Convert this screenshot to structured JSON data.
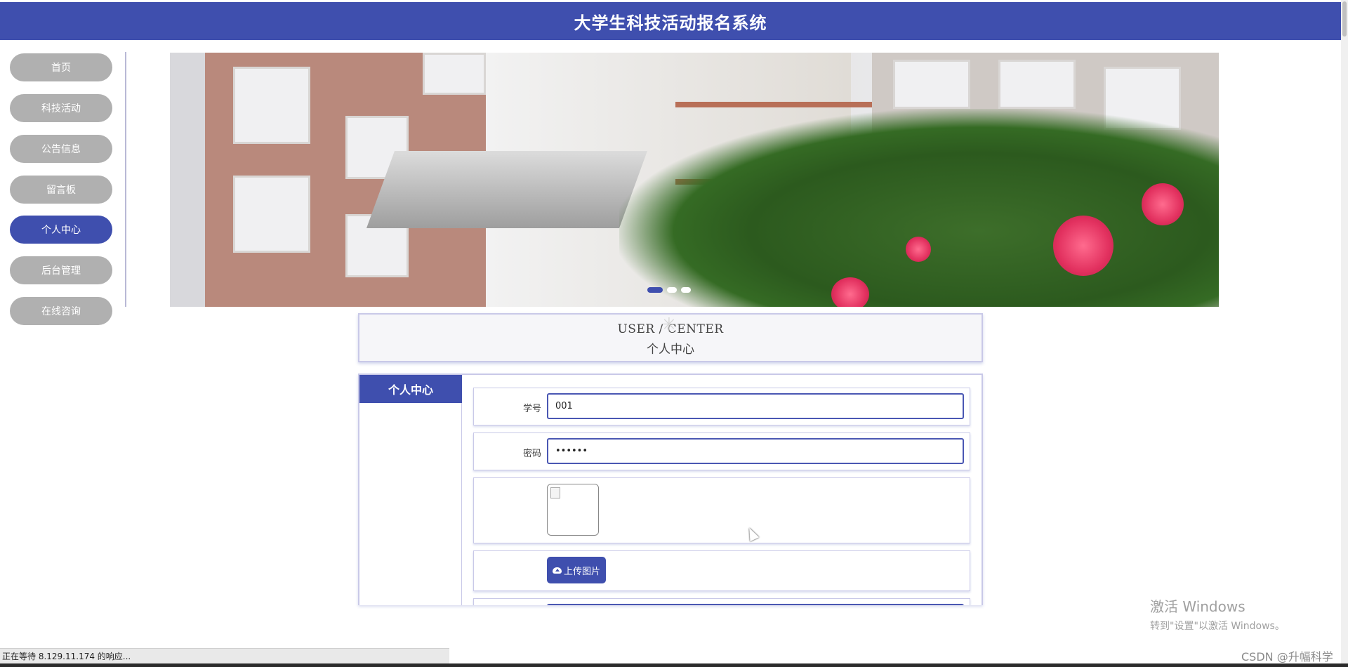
{
  "header": {
    "title": "大学生科技活动报名系统"
  },
  "sidebar": {
    "items": [
      {
        "label": "首页"
      },
      {
        "label": "科技活动"
      },
      {
        "label": "公告信息"
      },
      {
        "label": "留言板"
      },
      {
        "label": "个人中心",
        "active": true
      },
      {
        "label": "后台管理"
      },
      {
        "label": "在线咨询"
      }
    ]
  },
  "banner": {
    "slides": 3,
    "active_slide": 1
  },
  "section": {
    "title_en": "USER / CENTER",
    "title_zh": "个人中心"
  },
  "panel": {
    "tab_label": "个人中心",
    "fields": {
      "student_id": {
        "label": "学号",
        "value": "001"
      },
      "password": {
        "label": "密码",
        "value": "••••••"
      }
    },
    "upload_label": "上传图片"
  },
  "watermark": {
    "line1": "激活 Windows",
    "line2": "转到\"设置\"以激活 Windows。"
  },
  "csdn": "CSDN @升幅科学",
  "status": "正在等待 8.129.11.174 的响应...",
  "colors": {
    "primary": "#3f4fae",
    "nav_inactive": "#b0b0b0"
  }
}
